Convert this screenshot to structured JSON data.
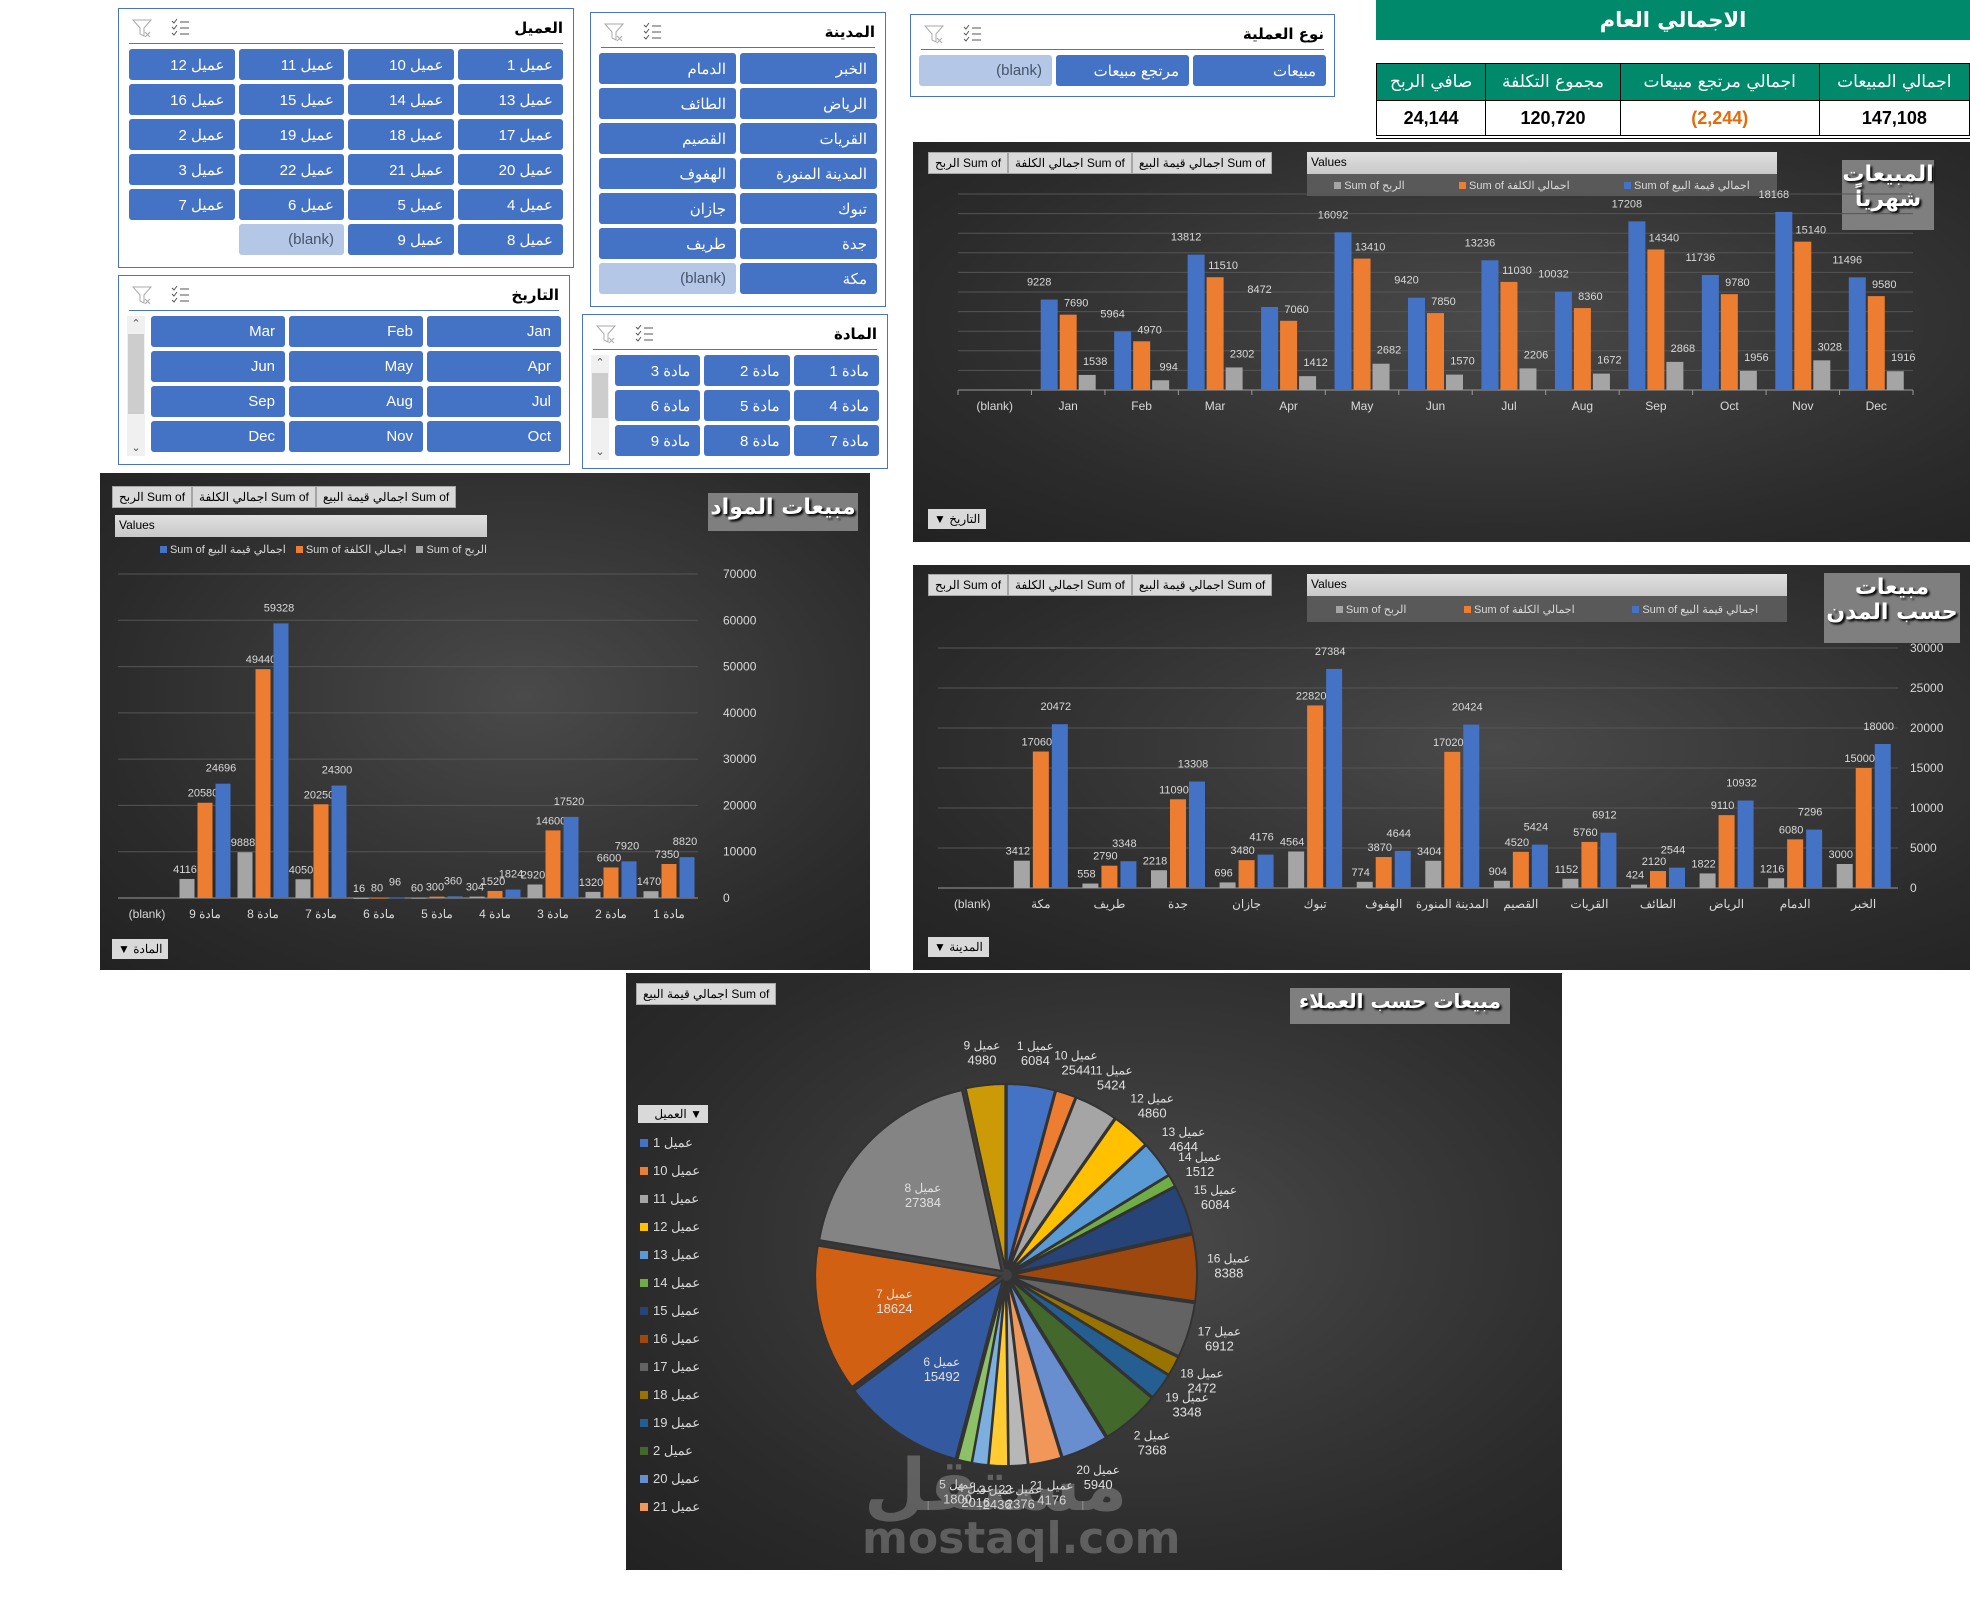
{
  "summary": {
    "title": "الاجمالي العام",
    "headers": [
      "اجمالي المبيعات",
      "اجمالي مرتجع مبيعات",
      "مجموع التكلفة",
      "صافي الربح"
    ],
    "values": [
      "147,108",
      "(2,244)",
      "120,720",
      "24,144"
    ],
    "negative_color": "#e26b0a",
    "accent_color": "#00896b"
  },
  "slicers": {
    "customer": {
      "title": "العميل",
      "items": [
        "عميل 1",
        "عميل 10",
        "عميل 11",
        "عميل 12",
        "عميل 13",
        "عميل 14",
        "عميل 15",
        "عميل 16",
        "عميل 17",
        "عميل 18",
        "عميل 19",
        "عميل 2",
        "عميل 20",
        "عميل 21",
        "عميل 22",
        "عميل 3",
        "عميل 4",
        "عميل 5",
        "عميل 6",
        "عميل 7",
        "عميل 8",
        "عميل 9",
        "(blank)"
      ]
    },
    "city": {
      "title": "المدينة",
      "items": [
        "الخبر",
        "الدمام",
        "الرياض",
        "الطائف",
        "القريات",
        "القصيم",
        "المدينة المنورة",
        "الهفوف",
        "تبوك",
        "جازان",
        "جدة",
        "طريف",
        "مكة",
        "(blank)"
      ]
    },
    "operation": {
      "title": "نوع العملية",
      "items": [
        "مبيعات",
        "مرتجع مبيعات",
        "(blank)"
      ]
    },
    "date": {
      "title": "التاريخ",
      "items": [
        "Jan",
        "Feb",
        "Mar",
        "Apr",
        "May",
        "Jun",
        "Jul",
        "Aug",
        "Sep",
        "Oct",
        "Nov",
        "Dec"
      ]
    },
    "material": {
      "title": "المادة",
      "items": [
        "مادة 1",
        "مادة 2",
        "مادة 3",
        "مادة 4",
        "مادة 5",
        "مادة 6",
        "مادة 7",
        "مادة 8",
        "مادة 9"
      ]
    },
    "clear_filter_icon": "filter-clear-icon",
    "multi_select_icon": "multi-select-icon",
    "selected_color": "#4472c4",
    "blank_color": "#b4c7e7"
  },
  "field_buttons": {
    "profit": "Sum of الربح",
    "cost": "Sum of اجمالي الكلفة",
    "sales": "Sum of اجمالي قيمة البيع",
    "values": "Values"
  },
  "chart_data": [
    {
      "id": "monthly",
      "type": "bar",
      "title": "المبيعات شهرياً",
      "axis_button": "التاريخ",
      "categories": [
        "(blank)",
        "Jan",
        "Feb",
        "Mar",
        "Apr",
        "May",
        "Jun",
        "Jul",
        "Aug",
        "Sep",
        "Oct",
        "Nov",
        "Dec"
      ],
      "series": [
        {
          "name": "Sum of اجمالي قيمة البيع",
          "color": "#4472c4",
          "values": [
            null,
            9228,
            5964,
            13812,
            8472,
            16092,
            9420,
            13236,
            10032,
            17208,
            11736,
            18168,
            11496
          ]
        },
        {
          "name": "Sum of اجمالي الكلفة",
          "color": "#ed7d31",
          "values": [
            null,
            7690,
            4970,
            11510,
            7060,
            13410,
            7850,
            11030,
            8360,
            14340,
            9780,
            15140,
            9580
          ]
        },
        {
          "name": "Sum of الربح",
          "color": "#a5a5a5",
          "values": [
            null,
            1538,
            994,
            2302,
            1412,
            2682,
            1570,
            2206,
            1672,
            2868,
            1956,
            3028,
            1916
          ]
        }
      ],
      "ylim": [
        0,
        20000
      ],
      "y_axis_visible": false,
      "grid": true,
      "legend": "top"
    },
    {
      "id": "materials",
      "type": "bar",
      "title": "مبيعات المواد",
      "axis_button": "المادة",
      "categories": [
        "(blank)",
        "مادة 9",
        "مادة 8",
        "مادة 7",
        "مادة 6",
        "مادة 5",
        "مادة 4",
        "مادة 3",
        "مادة 2",
        "مادة 1"
      ],
      "series": [
        {
          "name": "Sum of الربح",
          "color": "#a5a5a5",
          "values": [
            null,
            4116,
            9888,
            4050,
            16,
            60,
            304,
            2920,
            1320,
            1470
          ]
        },
        {
          "name": "Sum of اجمالي الكلفة",
          "color": "#ed7d31",
          "values": [
            null,
            20580,
            49440,
            20250,
            80,
            300,
            1520,
            14600,
            6600,
            7350
          ]
        },
        {
          "name": "Sum of اجمالي قيمة البيع",
          "color": "#4472c4",
          "values": [
            null,
            24696,
            59328,
            24300,
            96,
            360,
            1824,
            17520,
            7920,
            8820
          ]
        }
      ],
      "yticks": [
        0,
        10000,
        20000,
        30000,
        40000,
        50000,
        60000,
        70000
      ],
      "ylim": [
        0,
        70000
      ],
      "y_axis_side": "right",
      "grid": true,
      "legend": "top-left"
    },
    {
      "id": "cities",
      "type": "bar",
      "title": "مبيعات حسب المدن",
      "axis_button": "المدينة",
      "categories": [
        "(blank)",
        "مكة",
        "طريف",
        "جدة",
        "جازان",
        "تبوك",
        "الهفوف",
        "المدينة المنورة",
        "القصيم",
        "القريات",
        "الطائف",
        "الرياض",
        "الدمام",
        "الخبر"
      ],
      "series": [
        {
          "name": "Sum of الربح",
          "color": "#a5a5a5",
          "values": [
            null,
            3412,
            558,
            2218,
            696,
            4564,
            774,
            3404,
            904,
            1152,
            424,
            1822,
            1216,
            3000
          ]
        },
        {
          "name": "Sum of اجمالي الكلفة",
          "color": "#ed7d31",
          "values": [
            null,
            17060,
            2790,
            11090,
            3480,
            22820,
            3870,
            17020,
            4520,
            5760,
            2120,
            9110,
            6080,
            15000
          ]
        },
        {
          "name": "Sum of اجمالي قيمة البيع",
          "color": "#4472c4",
          "values": [
            null,
            20472,
            3348,
            13308,
            4176,
            27384,
            4644,
            20424,
            5424,
            6912,
            2544,
            10932,
            7296,
            18000
          ]
        }
      ],
      "yticks": [
        0,
        5000,
        10000,
        15000,
        20000,
        25000,
        30000
      ],
      "ylim": [
        0,
        30000
      ],
      "y_axis_side": "right",
      "grid": true,
      "legend": "top"
    },
    {
      "id": "customers",
      "type": "pie",
      "title": "مبيعات حسب العملاء",
      "field_button": "Sum of اجمالي قيمة البيع",
      "legend_title": "العميل",
      "legend": "left",
      "slices": [
        {
          "label": "عميل 1",
          "value": 6084,
          "color": "#4472c4"
        },
        {
          "label": "عميل 10",
          "value": 2544,
          "color": "#ed7d31"
        },
        {
          "label": "عميل 11",
          "value": 5424,
          "color": "#a5a5a5"
        },
        {
          "label": "عميل 12",
          "value": 4860,
          "color": "#ffc000"
        },
        {
          "label": "عميل 13",
          "value": 4644,
          "color": "#5b9bd5"
        },
        {
          "label": "عميل 14",
          "value": 1512,
          "color": "#70ad47"
        },
        {
          "label": "عميل 15",
          "value": 6084,
          "color": "#264478"
        },
        {
          "label": "عميل 16",
          "value": 8388,
          "color": "#9e480e"
        },
        {
          "label": "عميل 17",
          "value": 6912,
          "color": "#636363"
        },
        {
          "label": "عميل 18",
          "value": 2472,
          "color": "#997300"
        },
        {
          "label": "عميل 19",
          "value": 3348,
          "color": "#255e91"
        },
        {
          "label": "عميل 2",
          "value": 7368,
          "color": "#43682b"
        },
        {
          "label": "عميل 20",
          "value": 5940,
          "color": "#698ed0"
        },
        {
          "label": "عميل 21",
          "value": 4176,
          "color": "#f1975a"
        },
        {
          "label": "عميل 22",
          "value": 2376,
          "color": "#b7b7b7"
        },
        {
          "label": "عميل 3",
          "value": 2436,
          "color": "#ffcd33"
        },
        {
          "label": "عميل 4",
          "value": 2016,
          "color": "#7cafdd"
        },
        {
          "label": "عميل 5",
          "value": 1800,
          "color": "#8cc168"
        },
        {
          "label": "عميل 6",
          "value": 15492,
          "color": "#335aa1"
        },
        {
          "label": "عميل 7",
          "value": 18624,
          "color": "#d26012"
        },
        {
          "label": "عميل 8",
          "value": 27384,
          "color": "#848484"
        },
        {
          "label": "عميل 9",
          "value": 4980,
          "color": "#cc9a06"
        }
      ],
      "legend_visible_items": [
        "عميل 1",
        "عميل 10",
        "عميل 11",
        "عميل 12",
        "عميل 13",
        "عميل 14",
        "عميل 15",
        "عميل 16",
        "عميل 17",
        "عميل 18",
        "عميل 19",
        "عميل 2",
        "عميل 20",
        "عميل 21"
      ]
    }
  ],
  "watermark": {
    "arabic": "مستقل",
    "latin": "mostaql.com"
  }
}
